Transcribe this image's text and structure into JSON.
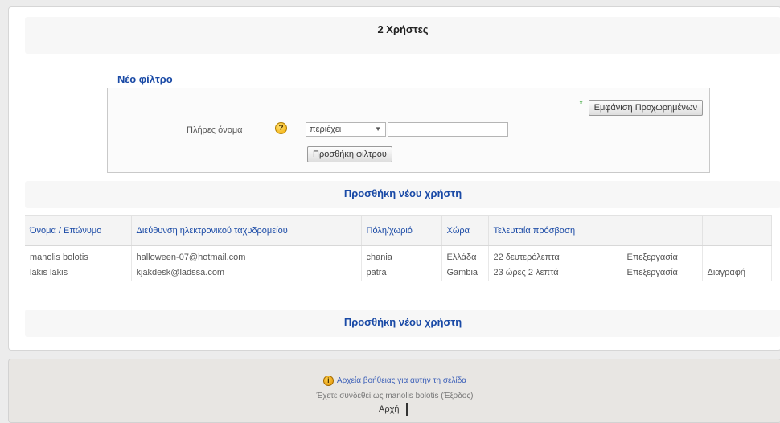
{
  "summary": {
    "users_count": "2 Χρήστες"
  },
  "filter": {
    "legend": "Νέο φίλτρο",
    "show_advanced": "Εμφάνιση Προχωρημένων",
    "field_label": "Πλήρες όνομα",
    "help_glyph": "?",
    "operator": "περιέχει",
    "value": "",
    "add_filter": "Προσθήκη φίλτρου"
  },
  "add_user_label": "Προσθήκη νέου χρήστη",
  "table": {
    "headers": [
      "Όνομα / Επώνυμο",
      "Διεύθυνση ηλεκτρονικού ταχυδρομείου",
      "Πόλη/χωριό",
      "Χώρα",
      "Τελευταία πρόσβαση",
      "",
      ""
    ],
    "rows": [
      {
        "name": "manolis bolotis",
        "email": "halloween-07@hotmail.com",
        "city": "chania",
        "country": "Ελλάδα",
        "last_access": "22 δευτερόλεπτα",
        "edit": "Επεξεργασία",
        "delete": ""
      },
      {
        "name": "lakis lakis",
        "email": "kjakdesk@ladssa.com",
        "city": "patra",
        "country": "Gambia",
        "last_access": "23 ώρες 2 λεπτά",
        "edit": "Επεξεργασία",
        "delete": "Διαγραφή"
      }
    ]
  },
  "footer": {
    "docs_link": "Αρχεία βοήθειας για αυτήν τη σελίδα",
    "logged_in": "Έχετε συνδεθεί ως manolis bolotis (Έξοδος)",
    "home": "Αρχή"
  },
  "colors": {
    "link": "#3b5fb8",
    "heading": "#1a4aa6",
    "asterisk": "#2ca02c"
  }
}
